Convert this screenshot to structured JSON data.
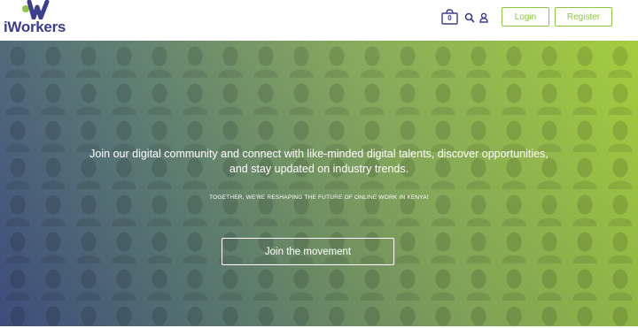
{
  "brand": {
    "name": "iWorkers",
    "logo_icon": "iworkers-logo-mark",
    "primary_color": "#3b3d8f",
    "accent_color": "#8dc63f"
  },
  "header": {
    "cart_icon": "basket-icon",
    "cart_count": "0",
    "search_icon": "search-icon",
    "user_icon": "user-icon",
    "login_label": "Login",
    "register_label": "Register"
  },
  "hero": {
    "headline": "Join our digital community and connect with like-minded digital talents, discover opportunities, and stay updated on industry trends.",
    "subheadline": "TOGETHER, WE'RE RESHAPING THE FUTURE OF ONLINE WORK IN KENYA!",
    "cta_label": "Join the movement",
    "gradient_start": "#3e4f80",
    "gradient_end": "#a3cc3a"
  }
}
